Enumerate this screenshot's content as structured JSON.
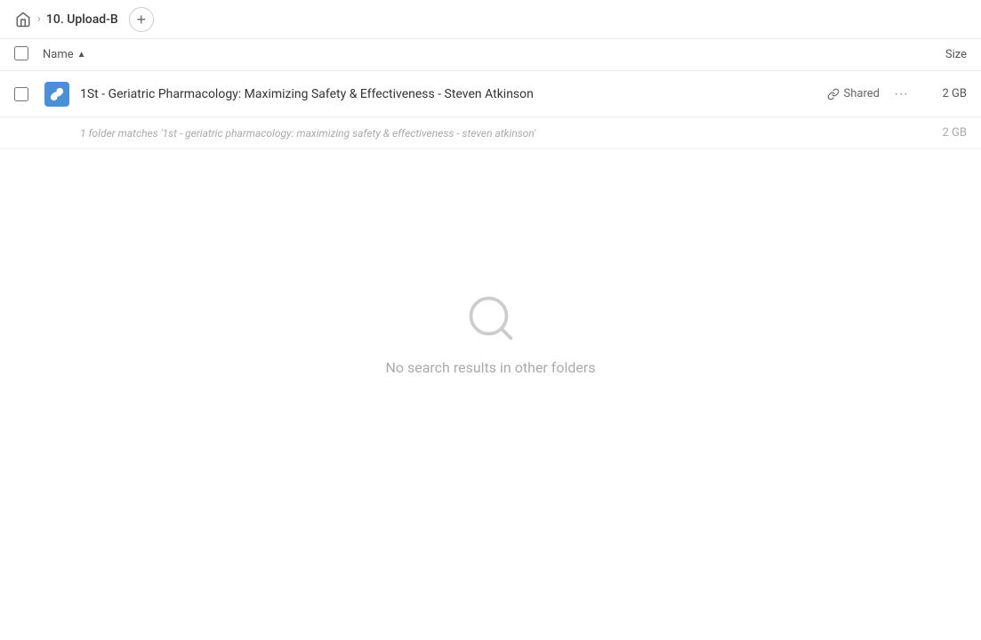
{
  "header": {
    "home_icon_label": "home",
    "breadcrumb": [
      {
        "label": "10. Upload-B"
      }
    ],
    "add_button_label": "+"
  },
  "columns": {
    "name_label": "Name",
    "size_label": "Size"
  },
  "files": [
    {
      "id": "file-1",
      "name": "1St - Geriatric Pharmacology: Maximizing Safety & Effectiveness - Steven Atkinson",
      "shared": true,
      "shared_label": "Shared",
      "size": "2 GB",
      "match_text": "1 folder matches '1st - geriatric pharmacology: maximizing safety & effectiveness - steven atkinson'",
      "match_size": "2 GB"
    }
  ],
  "empty_state": {
    "message": "No search results in other folders"
  }
}
